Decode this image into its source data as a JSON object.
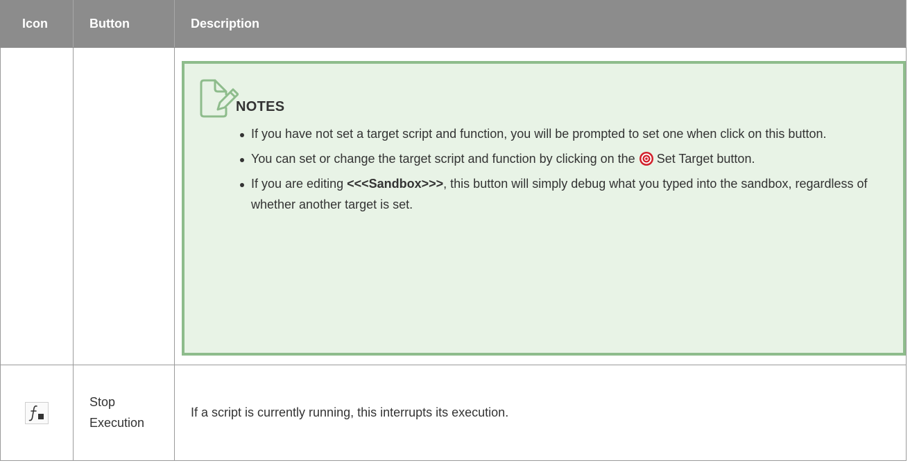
{
  "table": {
    "headers": {
      "icon": "Icon",
      "button": "Button",
      "description": "Description"
    }
  },
  "notes": {
    "title": "NOTES",
    "items": [
      {
        "text": "If you have not set a target script and function, you will be prompted to set one when click on this button."
      },
      {
        "before": "You can set or change the target script and function by clicking on the ",
        "icon": "target-icon",
        "after": "Set Target button."
      },
      {
        "before": "If you are editing ",
        "bold": "<<<Sandbox>>>",
        "after": ", this button will simply debug what you typed into the sandbox, regardless of whether another target is set."
      }
    ],
    "colors": {
      "background": "#e8f3e6",
      "border": "#8ebc8c",
      "target_icon": "#d21f2a"
    }
  },
  "rows": [
    {
      "icon": "stop-execution-icon",
      "button_label": "Stop Execution",
      "description": "If a script is currently running, this interrupts its execution."
    }
  ],
  "colors": {
    "header_background": "#8c8c8c",
    "header_text": "#ffffff",
    "grid": "#9a9a9a"
  }
}
